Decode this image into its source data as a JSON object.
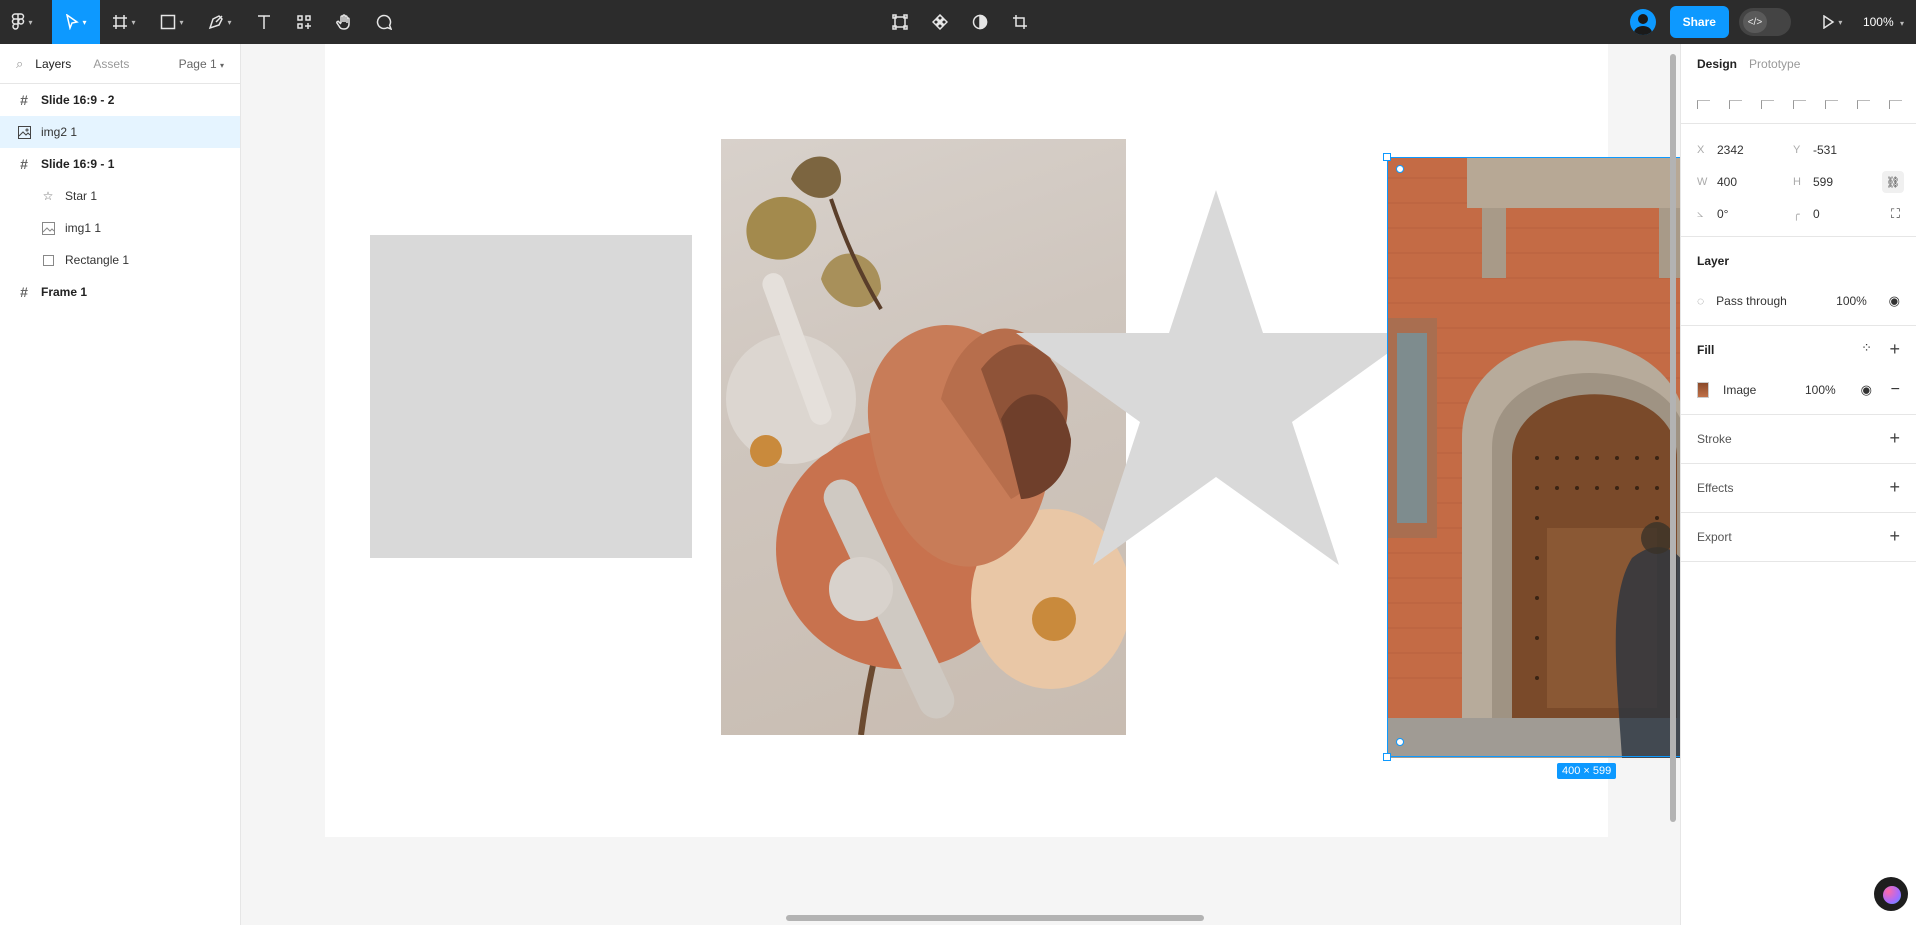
{
  "toolbar": {
    "zoom": "100%",
    "share_label": "Share",
    "dev_mode_icon": "</>"
  },
  "left_panel": {
    "tabs": [
      "Layers",
      "Assets"
    ],
    "page_selector": "Page 1",
    "layers": [
      {
        "name": "Slide 16:9 - 2",
        "icon": "frame-icon",
        "level": 0
      },
      {
        "name": "img2 1",
        "icon": "image-icon",
        "level": 0,
        "selected": true
      },
      {
        "name": "Slide 16:9 - 1",
        "icon": "frame-icon",
        "level": 0
      },
      {
        "name": "Star 1",
        "icon": "star-icon",
        "level": 1
      },
      {
        "name": "img1 1",
        "icon": "image-icon",
        "level": 1
      },
      {
        "name": "Rectangle 1",
        "icon": "rectangle-icon",
        "level": 1
      },
      {
        "name": "Frame 1",
        "icon": "frame-icon",
        "level": 0
      }
    ]
  },
  "canvas": {
    "selection_size_label": "400 × 599"
  },
  "right_panel": {
    "tabs": [
      "Design",
      "Prototype"
    ],
    "x_label": "X",
    "x_value": "2342",
    "y_label": "Y",
    "y_value": "-531",
    "w_label": "W",
    "w_value": "400",
    "h_label": "H",
    "h_value": "599",
    "rotation": "0°",
    "corner_radius": "0",
    "layer_title": "Layer",
    "blend_mode": "Pass through",
    "layer_opacity": "100%",
    "fill_title": "Fill",
    "fill_type": "Image",
    "fill_opacity": "100%",
    "stroke_title": "Stroke",
    "effects_title": "Effects",
    "export_title": "Export"
  },
  "colors": {
    "accent": "#0d99ff",
    "toolbar_bg": "#2c2c2c",
    "placeholder_gray": "#d9d9d9"
  }
}
